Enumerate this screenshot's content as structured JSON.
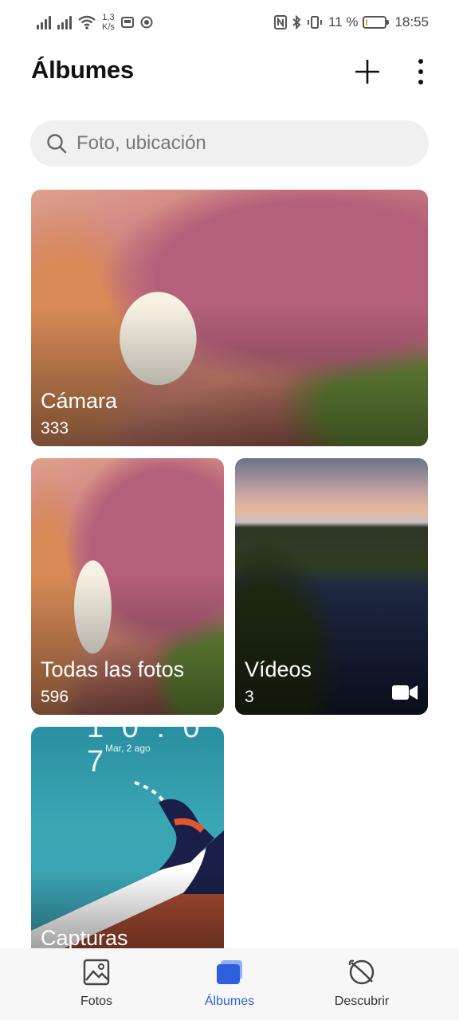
{
  "status_bar": {
    "net_speed_value": "1,3",
    "net_speed_unit": "K/s",
    "battery_percent": "11 %",
    "battery_level": 0.11,
    "time": "18:55"
  },
  "header": {
    "title": "Álbumes",
    "add_icon": "plus-icon",
    "more_icon": "more-vertical-icon"
  },
  "search": {
    "placeholder": "Foto, ubicación",
    "value": ""
  },
  "albums": [
    {
      "name": "Cámara",
      "count": "333"
    },
    {
      "name": "Todas las fotos",
      "count": "596"
    },
    {
      "name": "Vídeos",
      "count": "3",
      "badge_icon": "video-camera-icon"
    },
    {
      "name": "Capturas",
      "count": "",
      "preview_date": "Mar, 2 ago"
    }
  ],
  "bottom_nav": {
    "items": [
      {
        "label": "Fotos",
        "icon": "image-icon",
        "active": false
      },
      {
        "label": "Álbumes",
        "icon": "albums-icon",
        "active": true
      },
      {
        "label": "Descubrir",
        "icon": "discover-icon",
        "active": false
      }
    ],
    "active_color": "#2d5fe0"
  }
}
